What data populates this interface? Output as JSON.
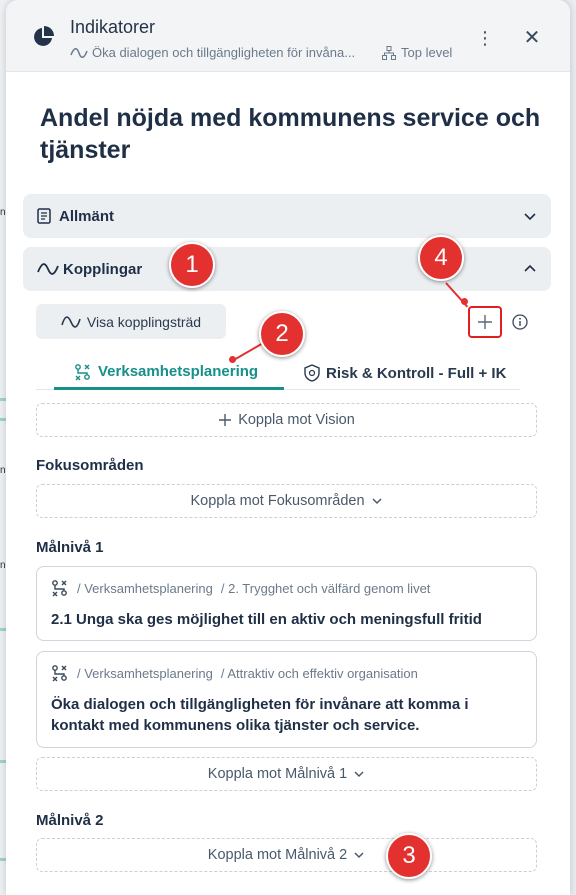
{
  "header": {
    "title": "Indikatorer",
    "subtitle": "Öka dialogen och tillgängligheten för invåna...",
    "level": "Top level"
  },
  "page_title": "Andel nöjda med kommunens service och tjänster",
  "sections": {
    "allmant": "Allmänt",
    "kopplingar": "Kopplingar"
  },
  "buttons": {
    "visa_kopplingstrad": "Visa kopplingsträd",
    "add": "+"
  },
  "tabs": [
    {
      "label": "Verksamhetsplanering",
      "active": true
    },
    {
      "label": "Risk & Kontroll - Full + IK",
      "active": false
    }
  ],
  "koppla_vision": "Koppla mot Vision",
  "fokusomraden": {
    "label": "Fokusområden",
    "action": "Koppla mot Fokusområden"
  },
  "malniva1": {
    "label": "Målnivå 1",
    "cards": [
      {
        "crumb_1": "/ Verksamhetsplanering",
        "crumb_2": "/ 2. Trygghet och välfärd genom livet",
        "title": "2.1 Unga ska ges möjlighet till en aktiv och meningsfull fritid"
      },
      {
        "crumb_1": "/ Verksamhetsplanering",
        "crumb_2": "/ Attraktiv och effektiv organisation",
        "title": "Öka dialogen och tillgängligheten för invånare att komma i kontakt med kommunens olika tjänster och service."
      }
    ],
    "action": "Koppla mot Målnivå 1"
  },
  "malniva2": {
    "label": "Målnivå 2",
    "action": "Koppla mot Målnivå 2"
  },
  "annotations": [
    "1",
    "2",
    "3",
    "4"
  ],
  "background_fragments": [
    "n",
    "n",
    "n"
  ],
  "colors": {
    "accent": "#15908a",
    "annotation_red": "#e3312f",
    "title": "#1f2f46"
  },
  "icons": [
    "pie-chart-icon",
    "link-wave-icon",
    "hierarchy-icon",
    "kebab-icon",
    "close-icon",
    "document-icon",
    "chevron-down-icon",
    "chevron-up-icon",
    "plus-icon",
    "info-icon",
    "verksamhet-icon",
    "shield-icon"
  ]
}
